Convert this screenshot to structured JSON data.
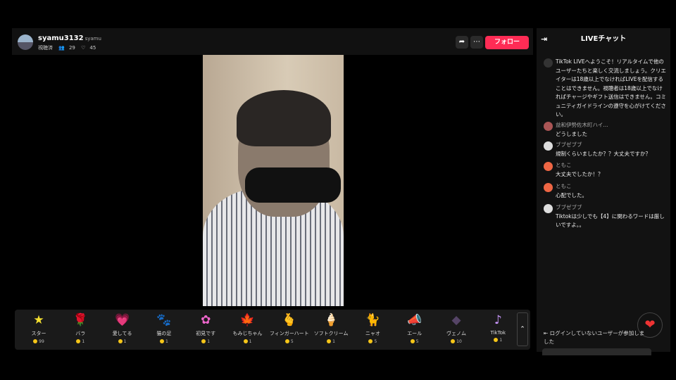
{
  "header": {
    "username": "syamu3132",
    "handle": "syamu",
    "subtitle": "視聴済",
    "viewers": "29",
    "likes": "45",
    "follow_label": "フォロー",
    "share_icon": "share-icon",
    "more_icon": "more-icon"
  },
  "gifts": [
    {
      "name": "スター",
      "price": "99",
      "icon": "★",
      "color": "#f5e030"
    },
    {
      "name": "バラ",
      "price": "1",
      "icon": "🌹",
      "color": "#e23"
    },
    {
      "name": "愛してる",
      "price": "1",
      "icon": "💗",
      "color": "#f48"
    },
    {
      "name": "猫の足",
      "price": "1",
      "icon": "🐾",
      "color": "#eee"
    },
    {
      "name": "初見です",
      "price": "1",
      "icon": "✿",
      "color": "#e6c"
    },
    {
      "name": "もみじちゃん",
      "price": "1",
      "icon": "🍁",
      "color": "#e52"
    },
    {
      "name": "フィンガーハート",
      "price": "5",
      "icon": "🫰",
      "color": "#f96"
    },
    {
      "name": "ソフトクリーム",
      "price": "1",
      "icon": "🍦",
      "color": "#fbc"
    },
    {
      "name": "ニャオ",
      "price": "5",
      "icon": "🐈",
      "color": "#777"
    },
    {
      "name": "エール",
      "price": "5",
      "icon": "📣",
      "color": "#9c6"
    },
    {
      "name": "ヴェノム",
      "price": "10",
      "icon": "◆",
      "color": "#546"
    },
    {
      "name": "TikTok",
      "price": "1",
      "icon": "♪",
      "color": "#c9f"
    }
  ],
  "chat": {
    "title": "LIVEチャット",
    "messages": [
      {
        "name": "",
        "text": "TikTok LIVEへようこそ！リアルタイムで他のユーザーたちと楽しく交流しましょう。クリエイターは18歳以上でなければLIVEを配信することはできません。視聴者は18歳以上でなければチャージやギフト送信はできません。コミュニティガイドラインの遵守を心がけてください。",
        "avatar": "#333"
      },
      {
        "name": "益和伊勢佐木町ハイ...",
        "text": "どうしました",
        "avatar": "#a55"
      },
      {
        "name": "ブブゼブブ",
        "text": "規制くらいましたか？？大丈夫ですか？",
        "avatar": "#ddd"
      },
      {
        "name": "ともこ",
        "text": "大丈夫でしたか！？",
        "avatar": "#e64"
      },
      {
        "name": "ともこ",
        "text": "心配でした。",
        "avatar": "#e64"
      },
      {
        "name": "ブブゼブブ",
        "text": "Tiktokは少しでも【4】に関わるワードは厳しいですよ。。",
        "avatar": "#ddd"
      }
    ],
    "join_notice": "ログインしていないユーザーが参加しました"
  }
}
